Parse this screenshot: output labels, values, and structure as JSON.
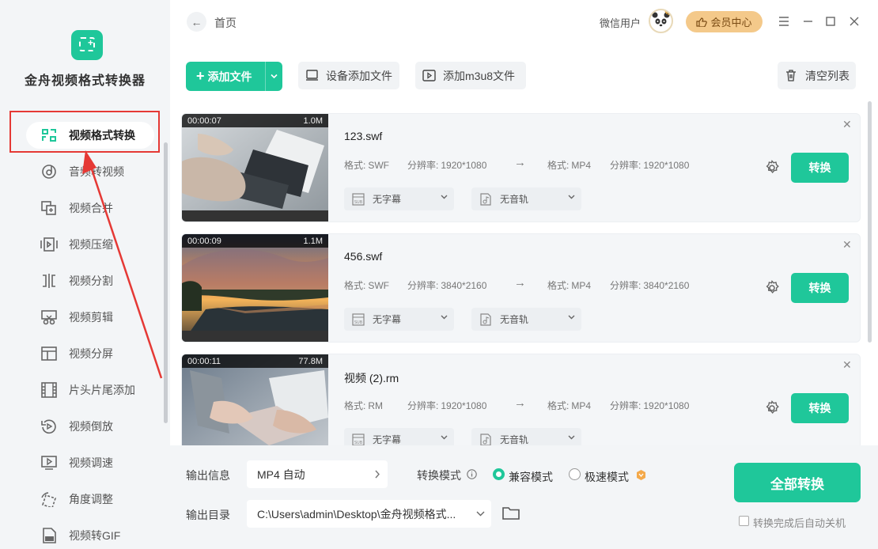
{
  "app": {
    "name": "金舟视频格式转换器"
  },
  "sidebar": {
    "items": [
      {
        "label": "视频格式转换",
        "icon": "convert-icon",
        "active": true
      },
      {
        "label": "音频转视频",
        "icon": "music-disc-icon"
      },
      {
        "label": "视频合并",
        "icon": "merge-icon"
      },
      {
        "label": "视频压缩",
        "icon": "compress-icon"
      },
      {
        "label": "视频分割",
        "icon": "split-icon"
      },
      {
        "label": "视频剪辑",
        "icon": "scissors-icon"
      },
      {
        "label": "视频分屏",
        "icon": "split-screen-icon"
      },
      {
        "label": "片头片尾添加",
        "icon": "film-icon"
      },
      {
        "label": "视频倒放",
        "icon": "reverse-icon"
      },
      {
        "label": "视频调速",
        "icon": "speed-icon"
      },
      {
        "label": "角度调整",
        "icon": "rotate-icon"
      },
      {
        "label": "视频转GIF",
        "icon": "gif-icon"
      }
    ]
  },
  "header": {
    "breadcrumb": "首页",
    "username": "微信用户",
    "vip_label": "会员中心"
  },
  "toolbar": {
    "add_file": "添加文件",
    "device_add": "设备添加文件",
    "add_m3u8": "添加m3u8文件",
    "clear_list": "清空列表"
  },
  "labels": {
    "format": "格式:",
    "resolution": "分辨率:",
    "subtitle": "无字幕",
    "audio_track": "无音轨",
    "convert": "转换"
  },
  "files": [
    {
      "duration": "00:00:07",
      "size": "1.0M",
      "name": "123.swf",
      "src_format": "SWF",
      "src_res": "1920*1080",
      "dst_format": "MP4",
      "dst_res": "1920*1080"
    },
    {
      "duration": "00:00:09",
      "size": "1.1M",
      "name": "456.swf",
      "src_format": "SWF",
      "src_res": "3840*2160",
      "dst_format": "MP4",
      "dst_res": "3840*2160"
    },
    {
      "duration": "00:00:11",
      "size": "77.8M",
      "name": "视频 (2).rm",
      "src_format": "RM",
      "src_res": "1920*1080",
      "dst_format": "MP4",
      "dst_res": "1920*1080"
    }
  ],
  "footer": {
    "output_info_label": "输出信息",
    "output_format": "MP4 自动",
    "mode_label": "转换模式",
    "mode_compat": "兼容模式",
    "mode_fast": "极速模式",
    "output_dir_label": "输出目录",
    "output_dir": "C:\\Users\\admin\\Desktop\\金舟视频格式...",
    "convert_all": "全部转换",
    "auto_shutdown": "转换完成后自动关机"
  },
  "colors": {
    "accent": "#1fc79a",
    "vip": "#f4c98a",
    "annotation": "#e53935"
  }
}
